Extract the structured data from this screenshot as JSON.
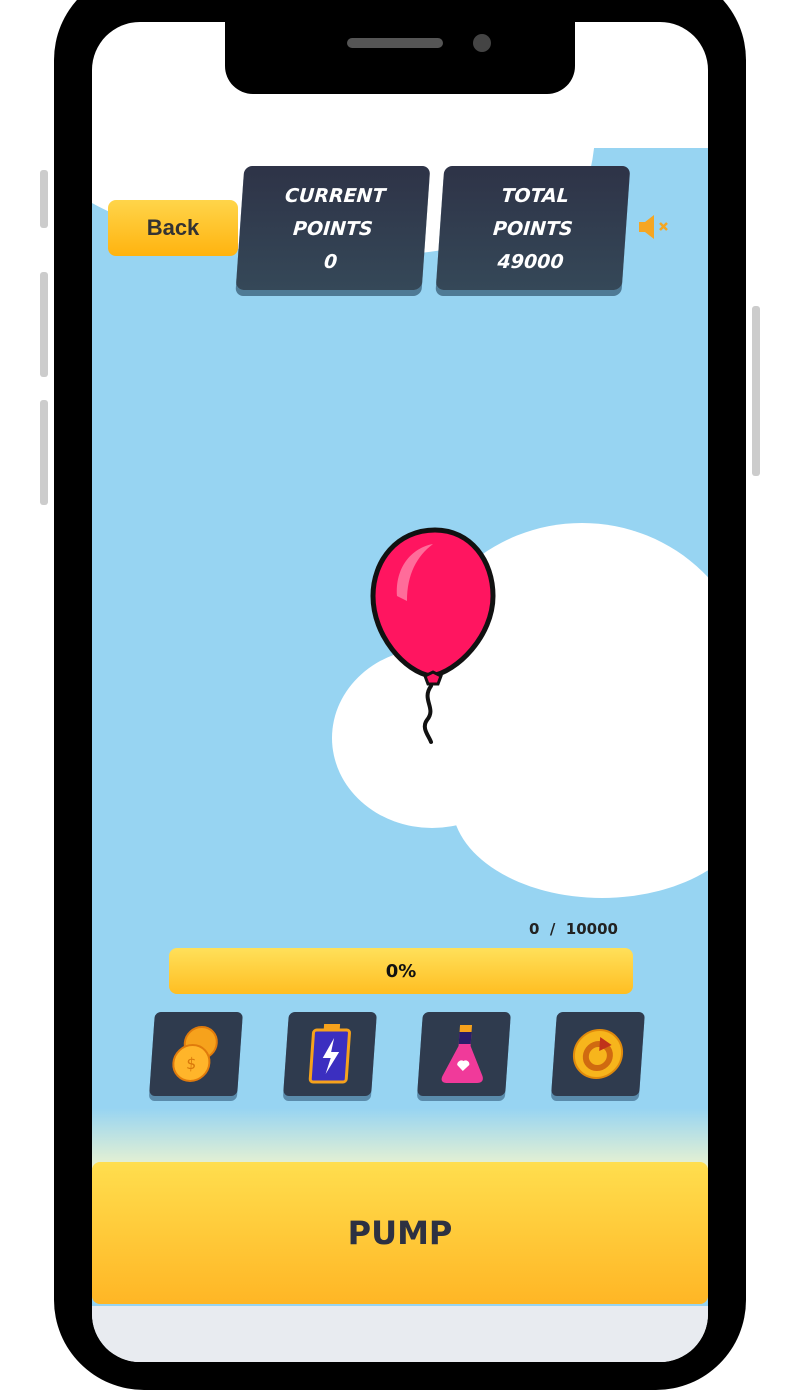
{
  "header": {
    "back_label": "Back",
    "mute_icon": "speaker-muted-icon"
  },
  "current_points": {
    "label_line1": "CURRENT",
    "label_line2": "POINTS",
    "value": "0"
  },
  "total_points": {
    "label_line1": "TOTAL",
    "label_line2": "POINTS",
    "value": "49000"
  },
  "progress": {
    "score_text": "0  /  10000",
    "percent_label": "0%",
    "percent": 0
  },
  "powerups": [
    {
      "icon": "coins-icon"
    },
    {
      "icon": "battery-icon"
    },
    {
      "icon": "potion-icon"
    },
    {
      "icon": "restart-coin-icon"
    }
  ],
  "pump_label": "PUMP",
  "colors": {
    "sky": "#97d4f2",
    "accent": "#ffc629",
    "balloon": "#ff1560",
    "card": "#2f3b4e"
  }
}
